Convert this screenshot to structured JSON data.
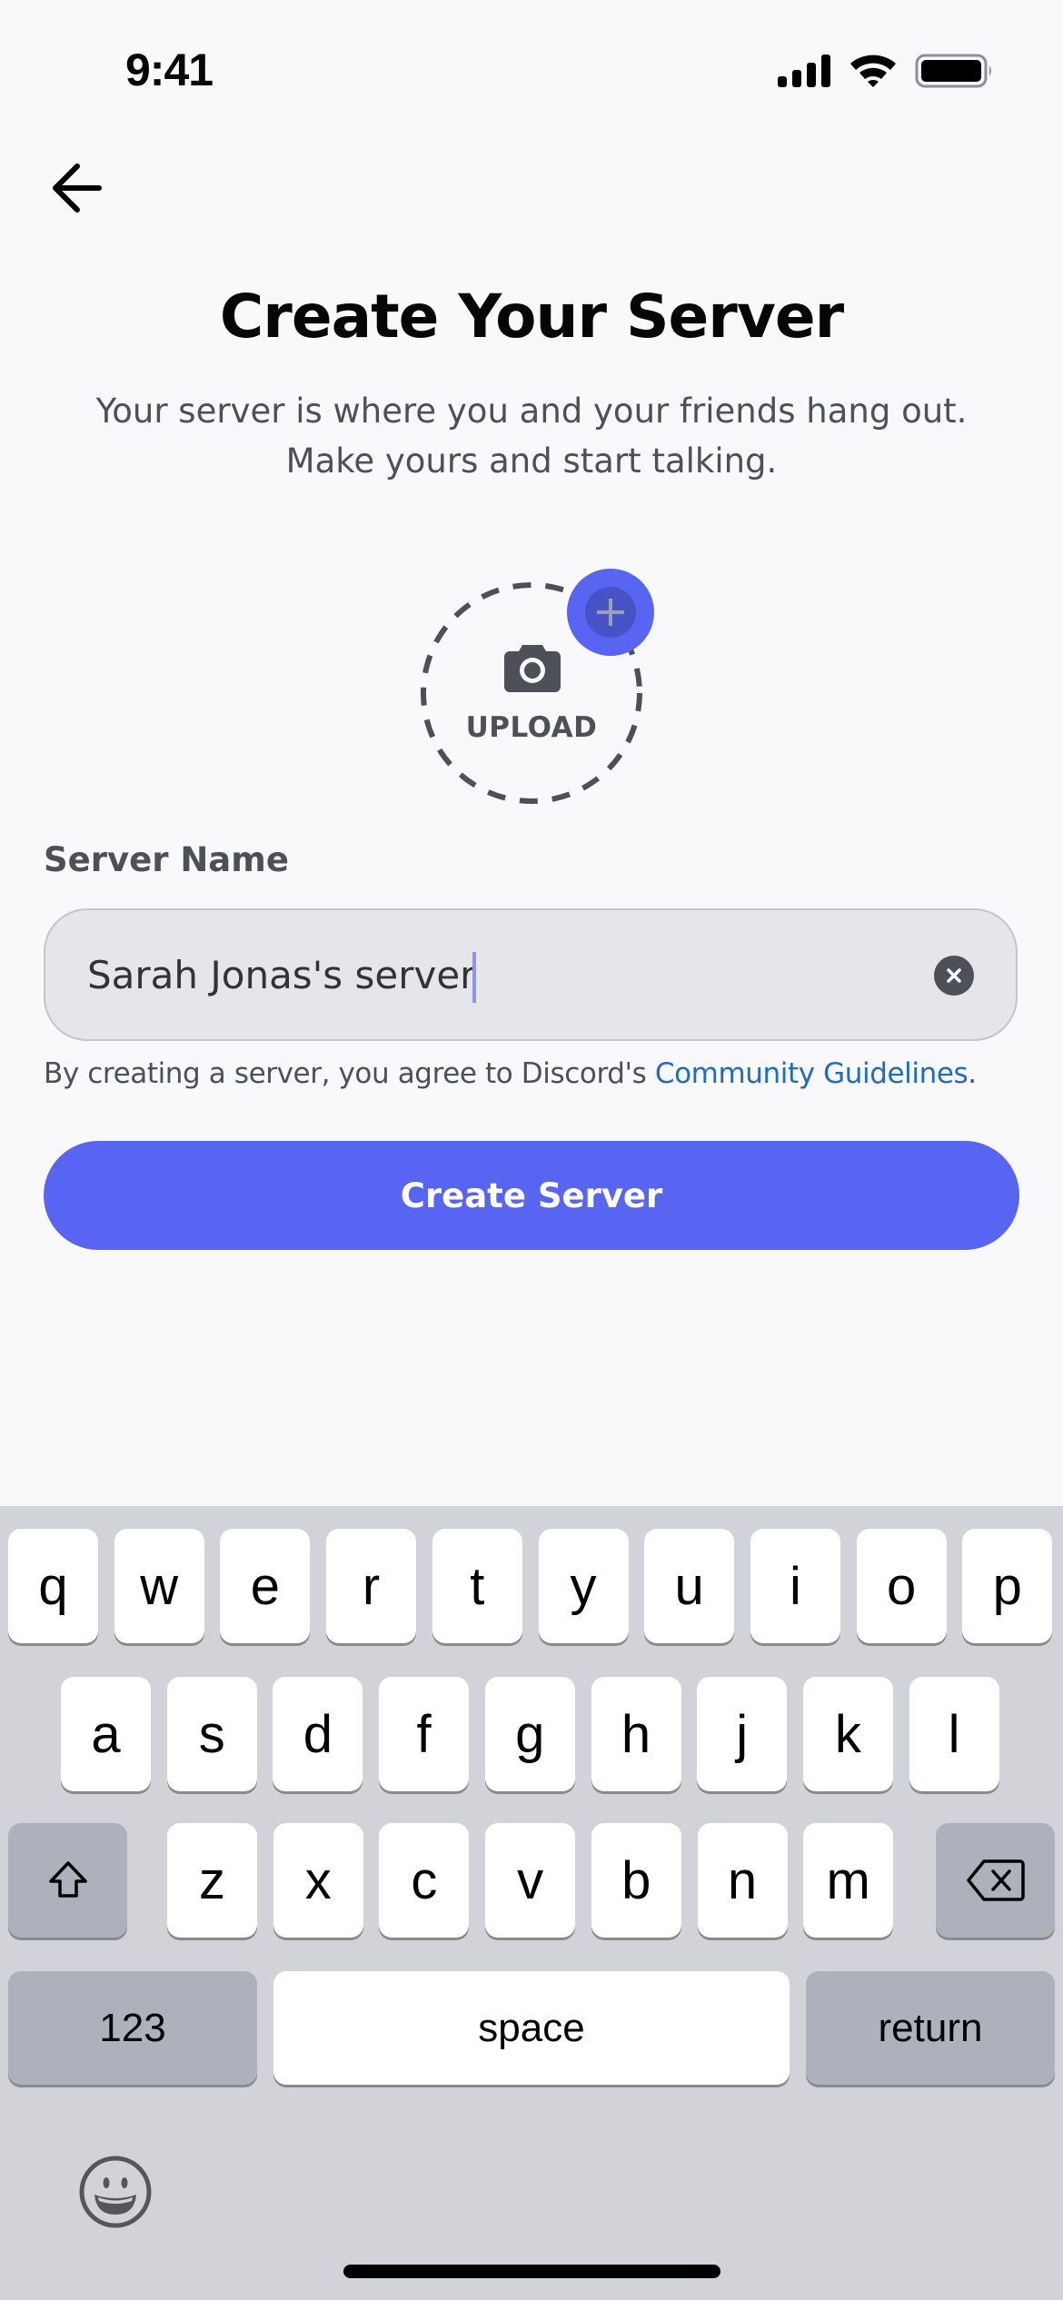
{
  "status_bar": {
    "time": "9:41",
    "icons": [
      "cellular-signal-icon",
      "wifi-icon",
      "battery-icon"
    ]
  },
  "nav": {
    "back_icon": "arrow-left-icon"
  },
  "header": {
    "title": "Create Your Server",
    "subtitle_line1": "Your server is where you and your friends hang out.",
    "subtitle_line2": "Make yours and start talking."
  },
  "upload": {
    "label": "UPLOAD",
    "icon": "camera-icon",
    "badge_icon": "plus-icon"
  },
  "form": {
    "label": "Server Name",
    "value": "Sarah Jonas's server",
    "clear_icon": "clear-x-icon",
    "helper_prefix": "By creating a server, you agree to Discord's ",
    "helper_link": "Community Guidelines",
    "helper_suffix": "."
  },
  "primary_button": {
    "label": "Create Server"
  },
  "colors": {
    "brand": "#5865f2",
    "link": "#1f6cc0",
    "background": "#f9f8fb"
  },
  "keyboard": {
    "row1": [
      "q",
      "w",
      "e",
      "r",
      "t",
      "y",
      "u",
      "i",
      "o",
      "p"
    ],
    "row2": [
      "a",
      "s",
      "d",
      "f",
      "g",
      "h",
      "j",
      "k",
      "l"
    ],
    "row3": [
      "z",
      "x",
      "c",
      "v",
      "b",
      "n",
      "m"
    ],
    "shift_icon": "shift-icon",
    "delete_icon": "delete-icon",
    "numbers_label": "123",
    "space_label": "space",
    "return_label": "return",
    "emoji_icon": "emoji-icon"
  }
}
